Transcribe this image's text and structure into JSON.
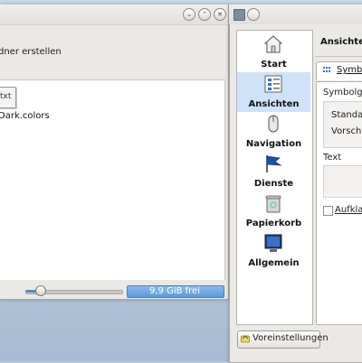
{
  "file_manager": {
    "toolbar_action": "dner erstellen",
    "file_icon_label": "txt",
    "file_name": "Dark.colors",
    "free_space": "9,9 GiB frei",
    "zoom_level": 0.15,
    "titlebar_buttons": [
      "minimize",
      "maximize",
      "close"
    ]
  },
  "settings": {
    "page_title": "Ansichten",
    "categories": [
      {
        "label": "Start",
        "icon": "home-icon"
      },
      {
        "label": "Ansichten",
        "icon": "views-icon",
        "selected": true
      },
      {
        "label": "Navigation",
        "icon": "mouse-icon"
      },
      {
        "label": "Dienste",
        "icon": "flag-icon"
      },
      {
        "label": "Papierkorb",
        "icon": "trash-icon"
      },
      {
        "label": "Allgemein",
        "icon": "monitor-icon"
      }
    ],
    "tab_label": "Symbo",
    "group_title": "Symbolgrö",
    "option_1": "Standard",
    "option_2": "Vorschau",
    "text_title": "Text",
    "checkbox_label": "Aufklap",
    "defaults_button": "Voreinstellungen"
  }
}
